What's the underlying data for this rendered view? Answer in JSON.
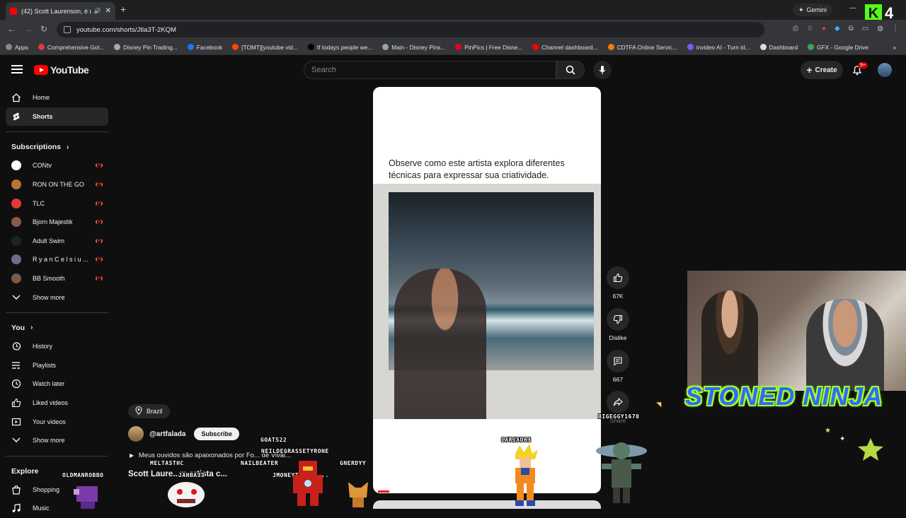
{
  "browser": {
    "tab_title": "(42) Scott Laurenson, é um",
    "new_tab": "+",
    "gemini_label": "Gemini",
    "url": "youtube.com/shorts/Jtla3T-2KQM",
    "bookmarks": [
      "Apps",
      "Comprehensive Gol...",
      "Disney Pin Trading...",
      "Facebook",
      "[TOMT][youtube vid...",
      "If todays people we...",
      "Main - Disney Pins...",
      "PinPics | Free Disne...",
      "Channel dashboard...",
      "CDTFA Online Servic...",
      "invideo AI - Turn id...",
      "Dashboard",
      "GFX - Google Drive"
    ]
  },
  "kick_badge": {
    "letter": "K",
    "number": "4"
  },
  "header": {
    "logo_text": "YouTube",
    "search_placeholder": "Search",
    "create_label": "Create",
    "notif_count": "9+"
  },
  "sidebar": {
    "main": [
      {
        "label": "Home",
        "icon": "home-icon"
      },
      {
        "label": "Shorts",
        "icon": "shorts-icon",
        "active": true
      }
    ],
    "subscriptions_title": "Subscriptions",
    "subscriptions": [
      {
        "label": "CONtv",
        "color": "#ffffff"
      },
      {
        "label": "RON ON THE GO",
        "color": "#b8733a"
      },
      {
        "label": "TLC",
        "color": "#e53935"
      },
      {
        "label": "Bjorn Majestik",
        "color": "#8a5a4a"
      },
      {
        "label": "Adult Swim",
        "color": "#222222"
      },
      {
        "label": "R y a n C e l s i u ...",
        "color": "#6d6d8a"
      },
      {
        "label": "BB Smooth",
        "color": "#7a5a48"
      }
    ],
    "show_more": "Show more",
    "you_title": "You",
    "you_items": [
      {
        "label": "History",
        "icon": "history-icon"
      },
      {
        "label": "Playlists",
        "icon": "playlists-icon"
      },
      {
        "label": "Watch later",
        "icon": "clock-icon"
      },
      {
        "label": "Liked videos",
        "icon": "thumbs-up-icon"
      },
      {
        "label": "Your videos",
        "icon": "video-icon"
      },
      {
        "label": "Show more",
        "icon": "chevron-down-icon"
      }
    ],
    "explore_title": "Explore",
    "explore_items": [
      {
        "label": "Shopping",
        "icon": "bag-icon"
      },
      {
        "label": "Music",
        "icon": "music-icon"
      }
    ]
  },
  "short": {
    "caption": "Observe como este artista explora diferentes técnicas para expressar sua criatividade.",
    "likes": "67K",
    "dislike_label": "Dislike",
    "comments": "667",
    "share_label": "Share",
    "location": "Brazil",
    "channel": "@artfalada",
    "subscribe_label": "Subscribe",
    "description": "Meus ouvidos são apaixonados por Fo... de Vival...",
    "title": "Scott Laure...m artista c..."
  },
  "overlay": {
    "brand_text": "STONED NINJA",
    "gamer_tags": [
      "GOATS22",
      "NEILDEGRASSETYRONE",
      "MELTASTHC",
      "NAILBEATER",
      "GNERDYY",
      "OLDMANROBBO",
      "JAHBA33",
      "JMONEYTRILLI...",
      "CARJAD63",
      "BIGEGGY1678"
    ]
  }
}
